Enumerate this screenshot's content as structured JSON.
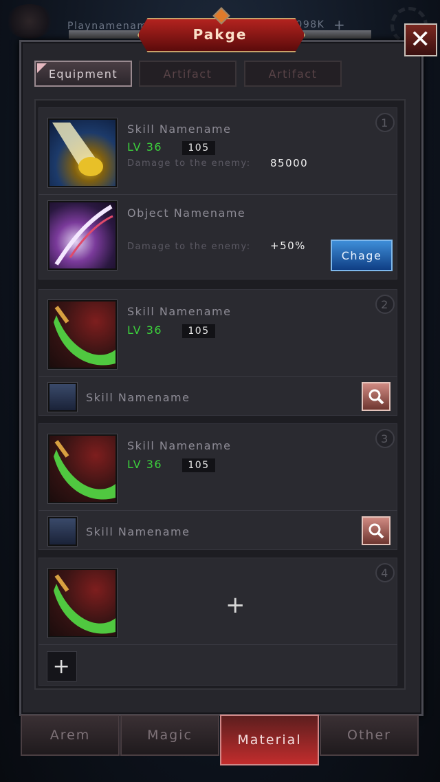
{
  "header": {
    "player_name": "Playnamename",
    "currency": "9098K",
    "currency_plus": "+",
    "title": "Pakge"
  },
  "tabs": [
    {
      "label": "Equipment",
      "active": true
    },
    {
      "label": "Artifact",
      "active": false
    },
    {
      "label": "Artifact",
      "active": false
    }
  ],
  "slots": [
    {
      "number": "1",
      "skill": {
        "name": "Skill Namename",
        "level": "LV 36",
        "value": "105",
        "stat_label": "Damage to the enemy:",
        "stat_value": "85000",
        "icon": "golden-fist-icon"
      },
      "object": {
        "name": "Object Namename",
        "stat_label": "Damage to the enemy:",
        "stat_value": "+50%",
        "icon": "claw-blade-icon",
        "button_label": "Chage"
      }
    },
    {
      "number": "2",
      "skill": {
        "name": "Skill Namename",
        "level": "LV 36",
        "value": "105",
        "icon": "green-blade-icon"
      },
      "sub": {
        "name": "Skill Namename",
        "icon": "ninja-icon"
      }
    },
    {
      "number": "3",
      "skill": {
        "name": "Skill Namename",
        "level": "LV 36",
        "value": "105",
        "icon": "green-blade-icon"
      },
      "sub": {
        "name": "Skill Namename",
        "icon": "ninja-icon"
      }
    },
    {
      "number": "4",
      "skill": {
        "icon": "green-blade-icon"
      },
      "add_label": "+"
    }
  ],
  "bottom_tabs": [
    {
      "label": "Arem",
      "active": false
    },
    {
      "label": "Magic",
      "active": false
    },
    {
      "label": "Material",
      "active": true
    },
    {
      "label": "Other",
      "active": false
    }
  ],
  "colors": {
    "level_green": "#3cd03c",
    "title_red": "#b3231f",
    "button_blue": "#1f63b8",
    "active_tab_red": "#c22d2d"
  }
}
